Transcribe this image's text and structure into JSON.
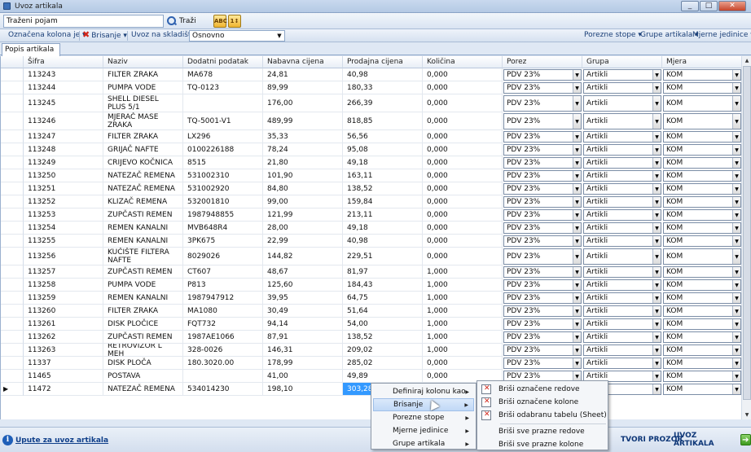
{
  "window": {
    "title": "Uvoz artikala",
    "min": "_",
    "max": "□",
    "close": "✕"
  },
  "toolbar": {
    "search_value": "Traženi pojam",
    "search_label": "Traži",
    "icon1": "ABC",
    "icon2": "1↕"
  },
  "toolbar2": {
    "marked_column": "Označena kolona je ▾",
    "delete": "Brisanje ▾",
    "warehouse_label": "Uvoz na skladište :",
    "warehouse_value": "Osnovno",
    "tax_rates": "Porezne stope ▾",
    "item_groups": "Grupe artikala ▾",
    "units": "Mjerne jedinice ▾"
  },
  "tab": {
    "label": "Popis artikala"
  },
  "columns": [
    "Šifra",
    "Naziv",
    "Dodatni podatak",
    "Nabavna cijena",
    "Prodajna cijena",
    "Količina",
    "Porez",
    "Grupa",
    "Mjera"
  ],
  "rows": [
    {
      "sifra": "113243",
      "naziv": "FILTER ZRAKA",
      "dodatni": "MA678",
      "nabavna": "24,81",
      "prodajna": "40,98",
      "kolicina": "0,000"
    },
    {
      "sifra": "113244",
      "naziv": "PUMPA VODE",
      "dodatni": "TQ-0123",
      "nabavna": "89,99",
      "prodajna": "180,33",
      "kolicina": "0,000"
    },
    {
      "sifra": "113245",
      "naziv": "SHELL DIESEL PLUS 5/1",
      "dodatni": "",
      "nabavna": "176,00",
      "prodajna": "266,39",
      "kolicina": "0,000"
    },
    {
      "sifra": "113246",
      "naziv": "MJERAČ MASE ZRAKA",
      "dodatni": "TQ-5001-V1",
      "nabavna": "489,99",
      "prodajna": "818,85",
      "kolicina": "0,000"
    },
    {
      "sifra": "113247",
      "naziv": "FILTER ZRAKA",
      "dodatni": "LX296",
      "nabavna": "35,33",
      "prodajna": "56,56",
      "kolicina": "0,000"
    },
    {
      "sifra": "113248",
      "naziv": "GRIJAČ NAFTE",
      "dodatni": "0100226188",
      "nabavna": "78,24",
      "prodajna": "95,08",
      "kolicina": "0,000"
    },
    {
      "sifra": "113249",
      "naziv": "CRIJEVO KOČNICA",
      "dodatni": "8515",
      "nabavna": "21,80",
      "prodajna": "49,18",
      "kolicina": "0,000"
    },
    {
      "sifra": "113250",
      "naziv": "NATEZAČ REMENA",
      "dodatni": "531002310",
      "nabavna": "101,90",
      "prodajna": "163,11",
      "kolicina": "0,000"
    },
    {
      "sifra": "113251",
      "naziv": "NATEZAČ REMENA",
      "dodatni": "531002920",
      "nabavna": "84,80",
      "prodajna": "138,52",
      "kolicina": "0,000"
    },
    {
      "sifra": "113252",
      "naziv": "KLIZAČ REMENA",
      "dodatni": "532001810",
      "nabavna": "99,00",
      "prodajna": "159,84",
      "kolicina": "0,000"
    },
    {
      "sifra": "113253",
      "naziv": "ZUPČASTI REMEN",
      "dodatni": "1987948855",
      "nabavna": "121,99",
      "prodajna": "213,11",
      "kolicina": "0,000"
    },
    {
      "sifra": "113254",
      "naziv": "REMEN KANALNI",
      "dodatni": "MVB648R4",
      "nabavna": "28,00",
      "prodajna": "49,18",
      "kolicina": "0,000"
    },
    {
      "sifra": "113255",
      "naziv": "REMEN KANALNI",
      "dodatni": "3PK675",
      "nabavna": "22,99",
      "prodajna": "40,98",
      "kolicina": "0,000"
    },
    {
      "sifra": "113256",
      "naziv": "KUČIŠTE FILTERA NAFTE",
      "dodatni": "8029026",
      "nabavna": "144,82",
      "prodajna": "229,51",
      "kolicina": "0,000"
    },
    {
      "sifra": "113257",
      "naziv": "ZUPČASTI REMEN",
      "dodatni": "CT607",
      "nabavna": "48,67",
      "prodajna": "81,97",
      "kolicina": "1,000"
    },
    {
      "sifra": "113258",
      "naziv": "PUMPA VODE",
      "dodatni": "P813",
      "nabavna": "125,60",
      "prodajna": "184,43",
      "kolicina": "1,000"
    },
    {
      "sifra": "113259",
      "naziv": "REMEN KANALNI",
      "dodatni": "1987947912",
      "nabavna": "39,95",
      "prodajna": "64,75",
      "kolicina": "1,000"
    },
    {
      "sifra": "113260",
      "naziv": "FILTER ZRAKA",
      "dodatni": "MA1080",
      "nabavna": "30,49",
      "prodajna": "51,64",
      "kolicina": "1,000"
    },
    {
      "sifra": "113261",
      "naziv": "DISK PLOČICE",
      "dodatni": "FQT732",
      "nabavna": "94,14",
      "prodajna": "54,00",
      "kolicina": "1,000"
    },
    {
      "sifra": "113262",
      "naziv": "ZUPČASTI REMEN",
      "dodatni": "1987AE1066",
      "nabavna": "87,91",
      "prodajna": "138,52",
      "kolicina": "1,000"
    },
    {
      "sifra": "113263",
      "naziv": "RETROVIZOR L MEH",
      "dodatni": "328-0026",
      "nabavna": "146,31",
      "prodajna": "209,02",
      "kolicina": "1,000"
    },
    {
      "sifra": "11337",
      "naziv": "DISK PLOČA",
      "dodatni": "180.3020.00",
      "nabavna": "178,99",
      "prodajna": "285,02",
      "kolicina": "0,000"
    },
    {
      "sifra": "11465",
      "naziv": "POSTAVA",
      "dodatni": "",
      "nabavna": "41,00",
      "prodajna": "49,89",
      "kolicina": "0,000"
    },
    {
      "sifra": "11472",
      "naziv": "NATEZAČ REMENA",
      "dodatni": "534014230",
      "nabavna": "198,10",
      "prodajna": "303,28",
      "kolicina": ""
    }
  ],
  "defaults": {
    "porez": "PDV 23%",
    "grupa": "Artikli",
    "mjera": "KOM"
  },
  "current_row_marker": "▶",
  "context_menu": {
    "items": [
      "Definiraj kolonu kao",
      "Brisanje",
      "Porezne stope",
      "Mjerne jedinice",
      "Grupe artikala"
    ],
    "submenu_arrow": "▶"
  },
  "submenu": {
    "items": [
      "Briši označene redove",
      "Briši označene kolone",
      "Briši odabranu tabelu (Sheet)",
      "Briši sve prazne redove",
      "Briši sve prazne kolone"
    ]
  },
  "footer": {
    "help_link": "Upute za uvoz artikala",
    "close_button": "TVORI PROZOR",
    "import_button": "UVOZ ARTIKALA",
    "import_arrow": "➔"
  },
  "colors": {
    "selection": "#3399ff",
    "delete_icon": "#d2261a",
    "link": "#0f3f8a"
  }
}
